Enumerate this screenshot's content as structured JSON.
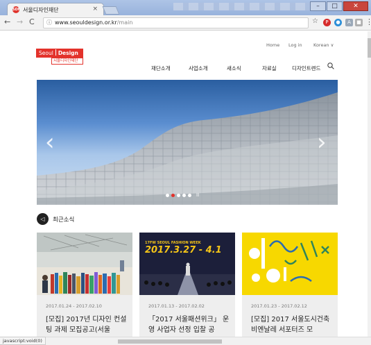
{
  "browser": {
    "tab_title": "서울디자인재단",
    "tab_favicon": "SDF",
    "tab_close": "×",
    "url_host": "www.seouldesign.or.kr",
    "url_path": "/main",
    "info_icon": "ⓘ",
    "status_text": "javascript:void(0)"
  },
  "header": {
    "logo_line1_a": "Seoul",
    "logo_line1_b": "Design",
    "logo_line2": "서울디자인재단",
    "util": [
      "Home",
      "Log in",
      "Korean"
    ],
    "menu": [
      "재단소개",
      "사업소개",
      "새소식",
      "자료실",
      "디자인트렌드"
    ]
  },
  "hero": {
    "prev": "‹",
    "next": "›",
    "pause": "II",
    "slides_total": 5,
    "active_slide": 2
  },
  "news": {
    "title": "최근소식",
    "cards": [
      {
        "date": "2017.01.24 - 2017.02.10",
        "title": "[모집] 2017년 디자인 컨설팅 과제 모집공고(서울"
      },
      {
        "date": "2017.01.13 - 2017.02.02",
        "title": "「2017 서울패션위크」 운영 사업자 선정 입찰 공"
      },
      {
        "date": "2017.01.23 - 2017.02.12",
        "title": "[모집] 2017 서울도시건축비엔날레 서포터즈 모"
      }
    ],
    "card2_banner_top": "17FW SEOUL FASHION WEEK",
    "card2_banner_date": "2017.3.27 - 4.1"
  },
  "colors": {
    "brand": "#e3322b"
  }
}
